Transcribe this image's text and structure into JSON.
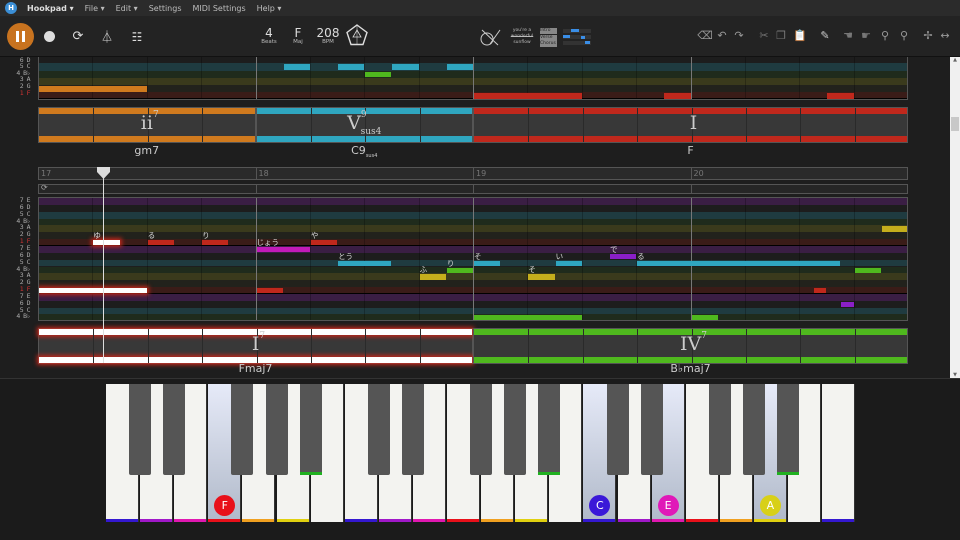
{
  "menu": {
    "logo": "H",
    "items": [
      "Hookpad",
      "File",
      "Edit",
      "Settings",
      "MIDI Settings",
      "Help"
    ]
  },
  "toolbar": {
    "beats": {
      "value": "4",
      "label": "Beats"
    },
    "key": {
      "value": "F",
      "label": "Maj"
    },
    "tempo": {
      "value": "208",
      "label": "BPM"
    },
    "thumb_text": [
      "you're a",
      "wonderful",
      "sunflow"
    ],
    "sections": [
      "Intro",
      "Verse",
      "Chorus"
    ]
  },
  "colors": {
    "accent": "#c8731f",
    "d1": "#c0281c",
    "d2": "#d07a1e",
    "d3": "#c4ae1c",
    "d4": "#4fb81e",
    "d5": "#2fa6c0",
    "d6": "#8a1fc8",
    "d7": "#c21ab8"
  },
  "row_labels": [
    [
      "7",
      "E"
    ],
    [
      "6",
      "D"
    ],
    [
      "5",
      "C"
    ],
    [
      "4",
      "B♭"
    ],
    [
      "3",
      "A"
    ],
    [
      "2",
      "G"
    ],
    [
      "1",
      "F"
    ]
  ],
  "top_section": {
    "notes": [
      {
        "start": 4.5,
        "len": 0.5,
        "row": 2,
        "deg": 5
      },
      {
        "start": 5.5,
        "len": 0.5,
        "row": 2,
        "deg": 5
      },
      {
        "start": 6.5,
        "len": 0.5,
        "row": 2,
        "deg": 5
      },
      {
        "start": 7.5,
        "len": 0.5,
        "row": 2,
        "deg": 5
      },
      {
        "start": 6,
        "len": 0.5,
        "row": 3,
        "deg": 4
      },
      {
        "start": 0,
        "len": 2,
        "row": 5,
        "deg": 2
      },
      {
        "start": 8,
        "len": 2,
        "row": 6,
        "deg": 1
      },
      {
        "start": 11.5,
        "len": 0.5,
        "row": 6,
        "deg": 1
      },
      {
        "start": 14.5,
        "len": 0.5,
        "row": 6,
        "deg": 1
      }
    ],
    "chords": [
      {
        "start": 0,
        "len": 4,
        "deg": 2,
        "numeral": "ii",
        "sup": "7",
        "sub": "",
        "name": "gm7",
        "name_sub": ""
      },
      {
        "start": 4,
        "len": 4,
        "deg": 5,
        "numeral": "V",
        "sup": "9",
        "sub": "sus4",
        "name": "C9",
        "name_sub": "sus4"
      },
      {
        "start": 8,
        "len": 8,
        "deg": 1,
        "numeral": "I",
        "sup": "",
        "sub": "",
        "name": "F",
        "name_sub": ""
      }
    ]
  },
  "bottom_section": {
    "measures": [
      "17",
      "18",
      "19",
      "20"
    ],
    "playhead_beat": 1.2,
    "notes": [
      {
        "start": 1,
        "len": 0.5,
        "row": 6,
        "deg": 1,
        "lyric": "ゆ",
        "active": true
      },
      {
        "start": 2,
        "len": 0.5,
        "row": 6,
        "deg": 1,
        "lyric": "る"
      },
      {
        "start": 3,
        "len": 0.5,
        "row": 6,
        "deg": 1,
        "lyric": "り"
      },
      {
        "start": 4,
        "len": 1,
        "row": 7,
        "deg": 7,
        "lyric": "じょう"
      },
      {
        "start": 5,
        "len": 0.5,
        "row": 6,
        "deg": 1,
        "lyric": "や"
      },
      {
        "start": 5.5,
        "len": 1,
        "row": 9,
        "deg": 5,
        "lyric": "とう"
      },
      {
        "start": 7,
        "len": 0.5,
        "row": 11,
        "deg": 3,
        "lyric": "ふ"
      },
      {
        "start": 7.5,
        "len": 0.5,
        "row": 10,
        "deg": 4,
        "lyric": "り"
      },
      {
        "start": 8,
        "len": 0.5,
        "row": 9,
        "deg": 5,
        "lyric": "そ"
      },
      {
        "start": 9,
        "len": 0.5,
        "row": 11,
        "deg": 3,
        "lyric": "そ"
      },
      {
        "start": 9.5,
        "len": 0.5,
        "row": 9,
        "deg": 5,
        "lyric": "い"
      },
      {
        "start": 10.5,
        "len": 0.5,
        "row": 8,
        "deg": 6,
        "lyric": "で"
      },
      {
        "start": 11,
        "len": 3.75,
        "row": 9,
        "deg": 5,
        "lyric": "る"
      },
      {
        "start": 15,
        "len": 0.5,
        "row": 10,
        "deg": 4
      },
      {
        "start": 15.5,
        "len": 0.5,
        "row": 4,
        "deg": 3
      },
      {
        "start": 0,
        "len": 2,
        "row": 13,
        "deg": 1,
        "active": true
      },
      {
        "start": 4,
        "len": 0.5,
        "row": 13,
        "deg": 1
      },
      {
        "start": 14.25,
        "len": 0.25,
        "row": 13,
        "deg": 1
      },
      {
        "start": 14.75,
        "len": 0.25,
        "row": 15,
        "deg": 6
      },
      {
        "start": 8,
        "len": 2,
        "row": 17,
        "deg": 4
      },
      {
        "start": 12,
        "len": 0.5,
        "row": 17,
        "deg": 4
      }
    ],
    "chords": [
      {
        "start": 0,
        "len": 8,
        "deg": 1,
        "numeral": "I",
        "sup": "7",
        "sub": "",
        "name": "Fmaj7",
        "name_sub": "",
        "active": true
      },
      {
        "start": 8,
        "len": 8,
        "deg": 4,
        "numeral": "IV",
        "sup": "7",
        "sub": "",
        "name": "B♭maj7",
        "name_sub": ""
      }
    ]
  },
  "piano": {
    "white_keys": [
      "C",
      "D",
      "E",
      "F",
      "G",
      "A",
      "B",
      "C",
      "D",
      "E",
      "F",
      "G",
      "A",
      "B",
      "C",
      "D",
      "E",
      "F",
      "G",
      "A",
      "B",
      "C"
    ],
    "highlighted": [
      {
        "index": 3,
        "label": "F",
        "color": "#e8101a"
      },
      {
        "index": 14,
        "label": "C",
        "color": "#3a18d8"
      },
      {
        "index": 16,
        "label": "E",
        "color": "#e018b8"
      },
      {
        "index": 19,
        "label": "A",
        "color": "#d8d018"
      }
    ]
  }
}
